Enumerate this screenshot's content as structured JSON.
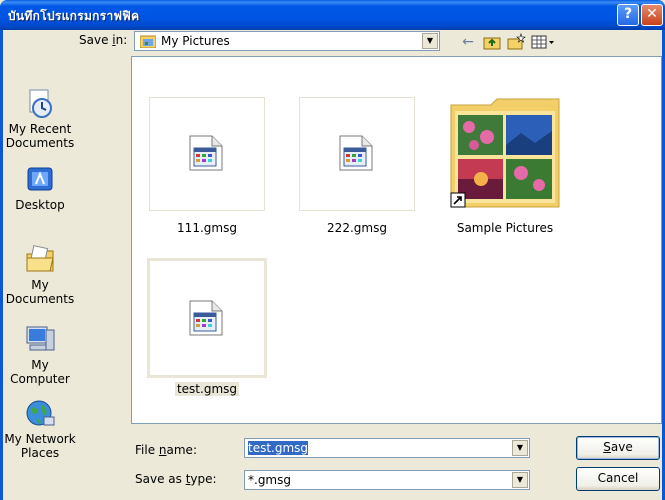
{
  "window": {
    "title": "บันทึกโปรแกรมกราฟฟิค",
    "help_glyph": "?",
    "close_glyph": "✕"
  },
  "save_in": {
    "label_prefix": "Save ",
    "label_accel": "i",
    "label_suffix": "n:",
    "value": "My Pictures"
  },
  "places": [
    {
      "label": "My Recent Documents",
      "icon": "recent-documents-icon"
    },
    {
      "label": "Desktop",
      "icon": "desktop-icon"
    },
    {
      "label": "My Documents",
      "icon": "my-documents-icon"
    },
    {
      "label": "My Computer",
      "icon": "my-computer-icon"
    },
    {
      "label": "My Network Places",
      "icon": "network-places-icon"
    }
  ],
  "files": [
    {
      "name": "111.gmsg",
      "type": "file"
    },
    {
      "name": "222.gmsg",
      "type": "file"
    },
    {
      "name": "Sample Pictures",
      "type": "folder-shortcut"
    },
    {
      "name": "test.gmsg",
      "type": "file",
      "selected": true
    }
  ],
  "file_name": {
    "label_prefix": "File ",
    "label_accel": "n",
    "label_suffix": "ame:",
    "value": "test.gmsg"
  },
  "save_as_type": {
    "label_prefix": "Save as ",
    "label_accel": "t",
    "label_suffix": "ype:",
    "value": "*.gmsg"
  },
  "buttons": {
    "save_accel": "S",
    "save_rest": "ave",
    "cancel": "Cancel"
  },
  "colors": {
    "title_bar": "#0054e3",
    "selection": "#316ac5",
    "dialog_bg": "#ece9d8"
  }
}
